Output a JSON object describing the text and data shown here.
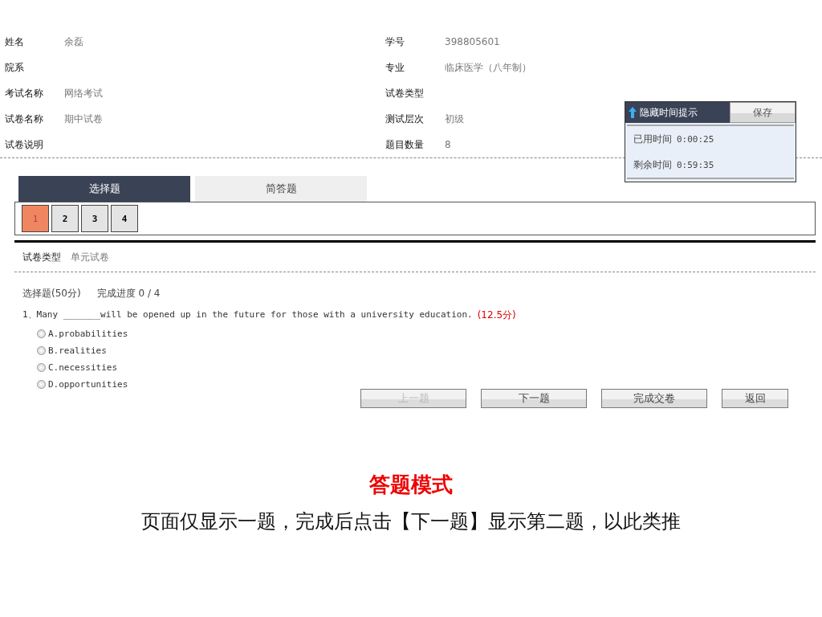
{
  "info_left": [
    {
      "label": "姓名",
      "value": "余磊"
    },
    {
      "label": "院系"
    },
    {
      "label": "考试名称",
      "value": "网络考试"
    },
    {
      "label": "试卷名称",
      "value": "期中试卷"
    },
    {
      "label": "试卷说明"
    }
  ],
  "info_right": [
    {
      "label": "学号",
      "value": "398805601"
    },
    {
      "label": "专业",
      "value": "临床医学（八年制）"
    },
    {
      "label": "试卷类型"
    },
    {
      "label": "测试层次",
      "value": "初级"
    },
    {
      "label": "题目数量",
      "value": "8"
    }
  ],
  "timer": {
    "toggle": "隐藏时间提示",
    "save": "保存",
    "used_label": "已用时间",
    "used": "0:00:25",
    "remaining_label": "剩余时间",
    "remaining": "0:59:35"
  },
  "tabs": [
    {
      "label": "选择题",
      "selected": true
    },
    {
      "label": "简答题",
      "selected": false
    }
  ],
  "question_nav": [
    {
      "label": "1",
      "selected": true
    },
    {
      "label": "2",
      "selected": false
    },
    {
      "label": "3",
      "selected": false
    },
    {
      "label": "4",
      "selected": false
    }
  ],
  "paper_type": {
    "label": "试卷类型",
    "value": "单元试卷"
  },
  "section": {
    "title": "选择题(50分)",
    "progress": "完成进度 0 / 4"
  },
  "question": {
    "text": "1、Many _______will be opened up in the future for those with a university education.",
    "score": "(12.5分)",
    "options": [
      {
        "label": "A.probabilities",
        "selected": false
      },
      {
        "label": "B.realities",
        "selected": false
      },
      {
        "label": "C.necessities",
        "selected": false
      },
      {
        "label": "D.opportunities",
        "selected": false
      }
    ]
  },
  "buttons": [
    {
      "label": "上一题",
      "disabled": true
    },
    {
      "label": "下一题",
      "disabled": false
    },
    {
      "label": "完成交卷",
      "disabled": false
    },
    {
      "label": "返回",
      "disabled": false
    }
  ],
  "caption": {
    "title": "答题模式",
    "text": "页面仅显示一题，完成后点击【下一题】显示第二题，以此类推"
  }
}
